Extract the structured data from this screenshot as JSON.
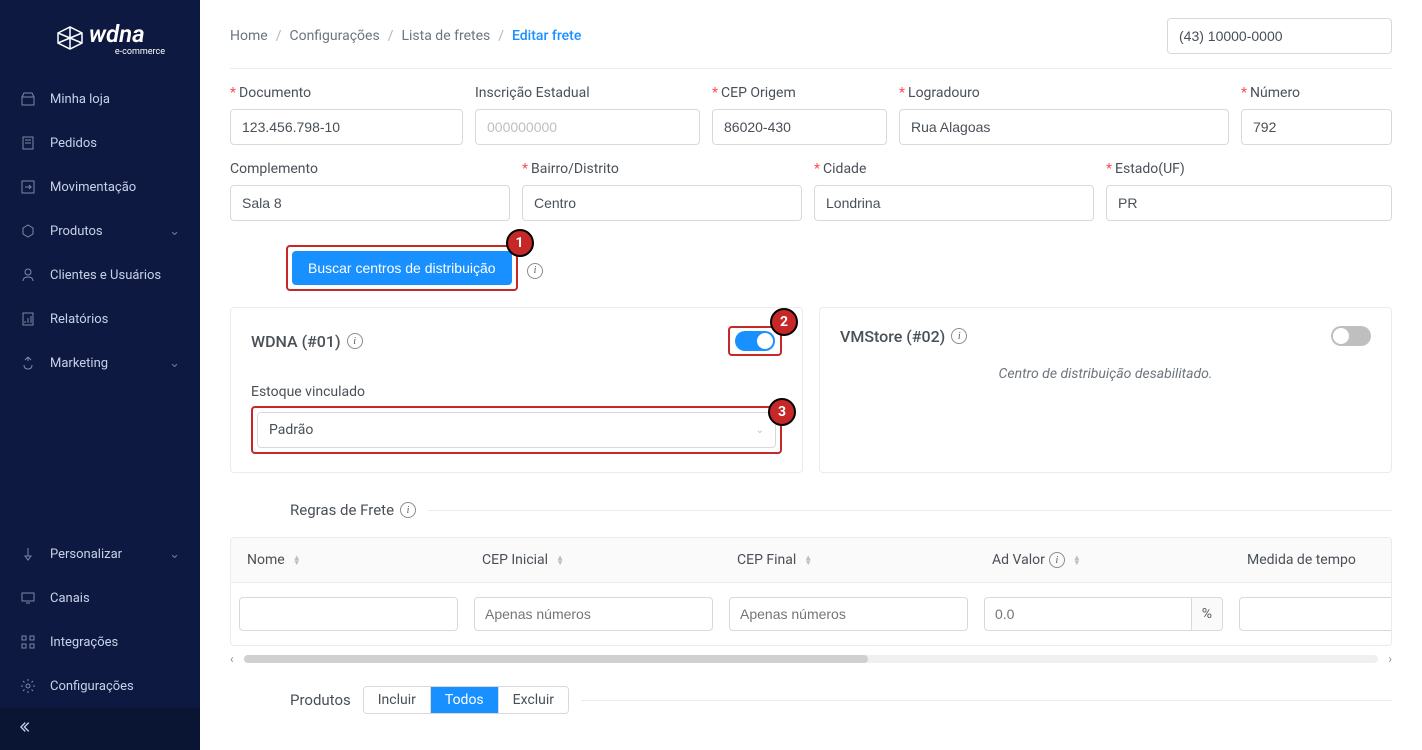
{
  "brand": {
    "name": "wdna",
    "subtitle": "e-commerce"
  },
  "sidebar": {
    "items": [
      {
        "label": "Minha loja"
      },
      {
        "label": "Pedidos"
      },
      {
        "label": "Movimentação"
      },
      {
        "label": "Produtos",
        "expandable": true
      },
      {
        "label": "Clientes e Usuários"
      },
      {
        "label": "Relatórios"
      },
      {
        "label": "Marketing",
        "expandable": true
      }
    ],
    "bottom_items": [
      {
        "label": "Personalizar",
        "expandable": true
      },
      {
        "label": "Canais"
      },
      {
        "label": "Integrações"
      },
      {
        "label": "Configurações"
      }
    ]
  },
  "breadcrumb": {
    "items": [
      "Home",
      "Configurações",
      "Lista de fretes"
    ],
    "current": "Editar frete"
  },
  "phone": {
    "value": "(43) 10000-0000"
  },
  "form": {
    "row1": {
      "documento": {
        "label": "Documento",
        "value": "123.456.798-10",
        "required": true
      },
      "ie": {
        "label": "Inscrição Estadual",
        "placeholder": "000000000"
      },
      "cep": {
        "label": "CEP Origem",
        "value": "86020-430",
        "required": true
      },
      "logradouro": {
        "label": "Logradouro",
        "value": "Rua Alagoas",
        "required": true
      },
      "numero": {
        "label": "Número",
        "value": "792",
        "required": true
      }
    },
    "row2": {
      "complemento": {
        "label": "Complemento",
        "value": "Sala 8"
      },
      "bairro": {
        "label": "Bairro/Distrito",
        "value": "Centro",
        "required": true
      },
      "cidade": {
        "label": "Cidade",
        "value": "Londrina",
        "required": true
      },
      "uf": {
        "label": "Estado(UF)",
        "value": "PR",
        "required": true
      }
    }
  },
  "buscar": {
    "label": "Buscar centros de distribuição"
  },
  "dist": {
    "card1": {
      "title": "WDNA (#01)",
      "on": true
    },
    "card2": {
      "title": "VMStore (#02)",
      "on": false,
      "disabled_msg": "Centro de distribuição desabilitado."
    },
    "estoque": {
      "label": "Estoque vinculado",
      "value": "Padrão"
    }
  },
  "markers": {
    "m1": "1",
    "m2": "2",
    "m3": "3"
  },
  "regras": {
    "title": "Regras de Frete",
    "columns": {
      "nome": "Nome",
      "cep_inicial": "CEP Inicial",
      "cep_final": "CEP Final",
      "ad_valor": "Ad Valor",
      "medida": "Medida de tempo"
    },
    "placeholders": {
      "cep": "Apenas números",
      "adv": "0.0",
      "pct": "%"
    }
  },
  "produtos": {
    "title": "Produtos",
    "options": [
      "Incluir",
      "Todos",
      "Excluir"
    ],
    "active": "Todos"
  }
}
